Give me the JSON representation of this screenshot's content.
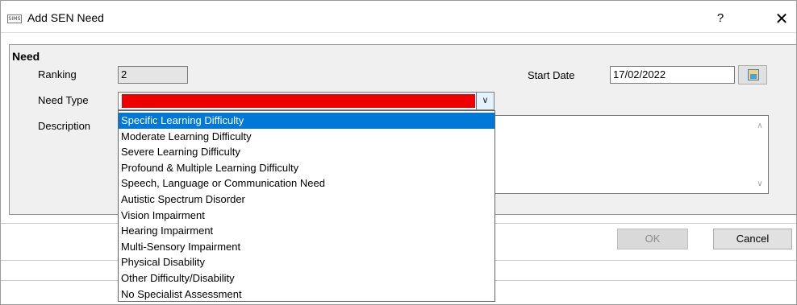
{
  "window": {
    "icon_text": "SIMS",
    "title": "Add SEN Need",
    "help_label": "?",
    "close_label": "✕"
  },
  "group": {
    "title": "Need"
  },
  "fields": {
    "ranking_label": "Ranking",
    "ranking_value": "2",
    "need_type_label": "Need Type",
    "description_label": "Description",
    "start_date_label": "Start Date",
    "start_date_value": "17/02/2022"
  },
  "colors": {
    "required_highlight": "#ee0000",
    "selection": "#0078d7"
  },
  "dropdown": {
    "options": [
      "Specific Learning Difficulty",
      "Moderate Learning Difficulty",
      "Severe Learning Difficulty",
      "Profound & Multiple Learning Difficulty",
      "Speech, Language or Communication Need",
      "Autistic Spectrum Disorder",
      "Vision Impairment",
      "Hearing Impairment",
      "Multi-Sensory Impairment",
      "Physical Disability",
      "Other Difficulty/Disability",
      "No Specialist Assessment"
    ],
    "highlighted": "Specific Learning Difficulty"
  },
  "buttons": {
    "ok_label": "OK",
    "cancel_label": "Cancel"
  }
}
